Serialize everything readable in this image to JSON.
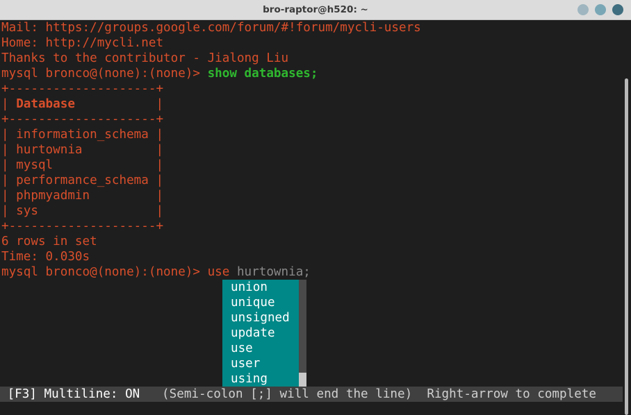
{
  "window": {
    "title": "bro-raptor@h520: ~",
    "buttons": [
      "minimize",
      "maximize",
      "close"
    ]
  },
  "terminal": {
    "intro": {
      "mail": "Mail: https://groups.google.com/forum/#!forum/mycli-users",
      "home": "Home: http://mycli.net",
      "thanks": "Thanks to the contributor - Jialong Liu"
    },
    "prompt": "mysql bronco@(none):(none)> ",
    "command1": "show databases;",
    "table": {
      "border": "+--------------------+",
      "header_left": "| ",
      "header": "Database",
      "header_right": "           |",
      "rows": [
        "| information_schema |",
        "| hurtownia          |",
        "| mysql              |",
        "| performance_schema |",
        "| phpmyadmin         |",
        "| sys                |"
      ]
    },
    "rows_in_set": "6 rows in set",
    "time": "Time: 0.030s",
    "command2_typed": "use",
    "command2_suggestion": " hurtownia;",
    "completions": [
      "union",
      "unique",
      "unsigned",
      "update",
      "use",
      "user",
      "using"
    ],
    "toolbar": {
      "key": "[F3]",
      "multiline": " Multiline: ON",
      "hint": "   (Semi-colon [;] will end the line)  Right-arrow to complete"
    }
  },
  "colors": {
    "output": "#d94f2b",
    "keyword": "#2fb82f",
    "completion_bg": "#008787",
    "toolbar_bg": "#404040",
    "background": "#1e1e1e"
  }
}
